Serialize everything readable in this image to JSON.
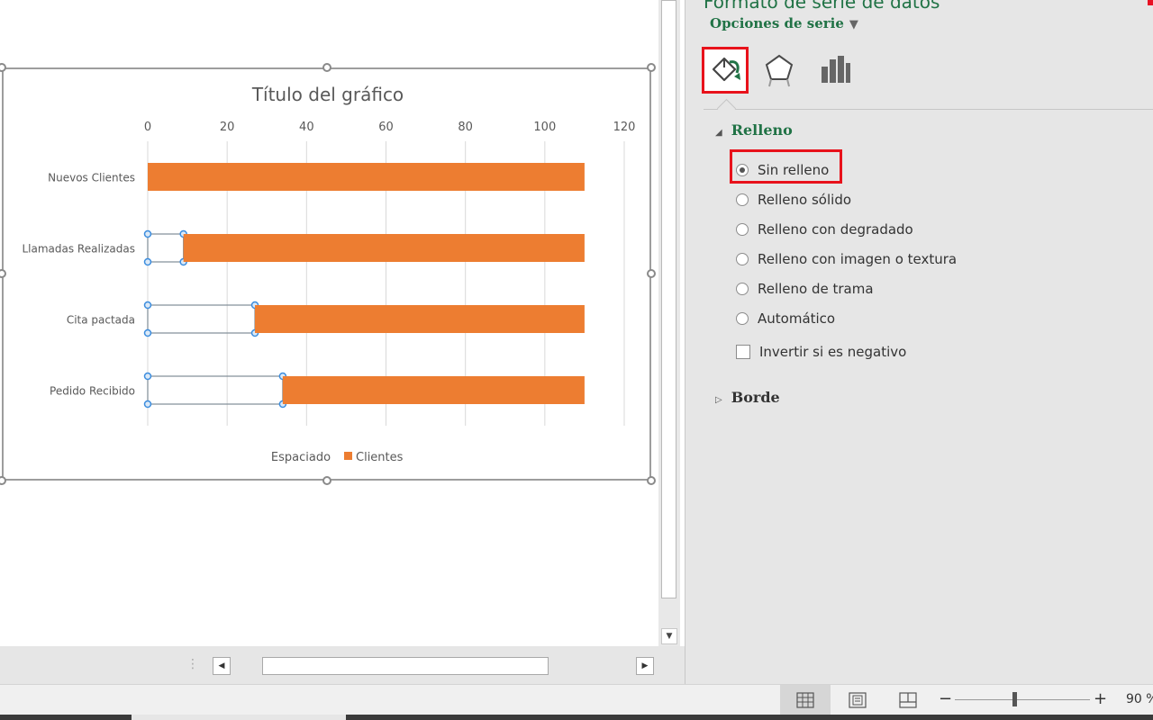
{
  "pane": {
    "title": "Formato de serie de datos",
    "dropdown_label": "Opciones de serie",
    "tabs": [
      "fill-line-icon",
      "effects-pentagon-icon",
      "series-options-bars-icon"
    ],
    "fill_section_label": "Relleno",
    "fill_options": [
      "Sin relleno",
      "Relleno sólido",
      "Relleno con degradado",
      "Relleno con imagen o textura",
      "Relleno de trama",
      "Automático"
    ],
    "selected_fill_option": "Sin relleno",
    "invert_label": "Invertir si es negativo",
    "invert_checked": false,
    "border_section_label": "Borde",
    "accent_color": "#217346",
    "highlight_color": "#e8121b"
  },
  "status_bar": {
    "zoom_label": "90 %",
    "zoom_percent": 90
  },
  "chart_data": {
    "type": "bar",
    "orientation": "horizontal",
    "stacked": true,
    "title": "Título del gráfico",
    "categories": [
      "Nuevos Clientes",
      "Llamadas Realizadas",
      "Cita pactada",
      "Pedido Recibido"
    ],
    "series": [
      {
        "name": "Espaciado",
        "values": [
          0,
          9,
          27,
          34
        ],
        "fill": "none",
        "selected": true
      },
      {
        "name": "Clientes",
        "values": [
          110,
          101,
          83,
          76
        ],
        "color": "#ed7d31"
      }
    ],
    "xlim": [
      0,
      120
    ],
    "x_ticks": [
      0,
      20,
      40,
      60,
      80,
      100,
      120
    ],
    "grid": true,
    "legend_position": "bottom"
  }
}
